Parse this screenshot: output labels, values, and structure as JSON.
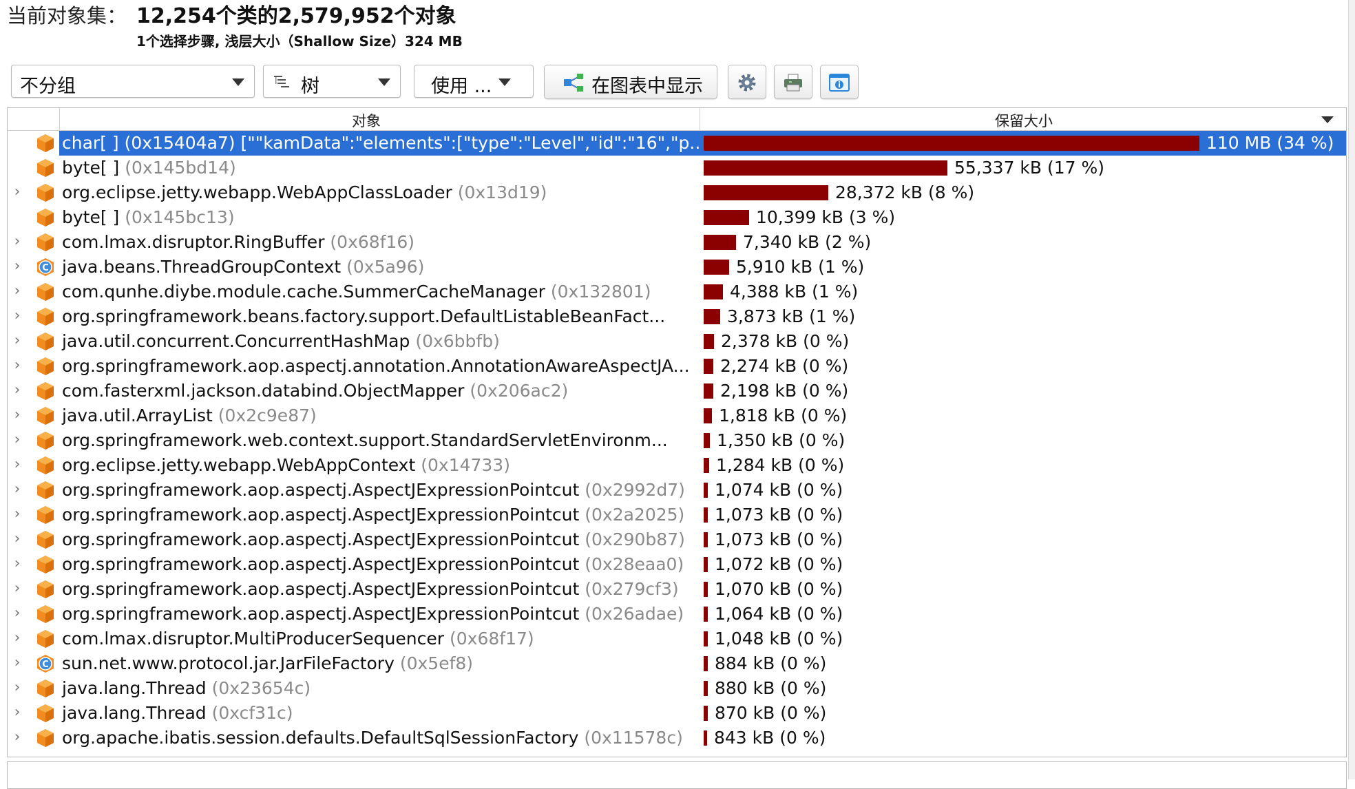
{
  "header": {
    "label": "当前对象集：",
    "title": "12,254个类的2,579,952个对象",
    "subtitle": "1个选择步骤, 浅层大小（Shallow Size）324 MB"
  },
  "toolbar": {
    "group_value": "不分组",
    "view_value": "树",
    "use_label": "使用 ...",
    "show_in_chart_label": "在图表中显示"
  },
  "table": {
    "col_object": "对象",
    "col_retained": "保留大小",
    "rows": [
      {
        "name": "char[ ] (0x15404a7) [\"\"kamData\":\"elements\":[\"type\":\"Level\",\"id\":\"16\",\"p...",
        "addr": "",
        "value": "110 MB (34 %)",
        "fraction": 1.0,
        "icon": "orange-cube-icon",
        "expandable": false,
        "selected": true
      },
      {
        "name": "byte[ ] ",
        "addr": "(0x145bd14)",
        "value": "55,337 kB (17 %)",
        "fraction": 0.491,
        "icon": "orange-cube-icon",
        "expandable": false
      },
      {
        "name": "org.eclipse.jetty.webapp.WebAppClassLoader ",
        "addr": "(0x13d19)",
        "value": "28,372 kB (8 %)",
        "fraction": 0.252,
        "icon": "orange-cube-icon",
        "expandable": true
      },
      {
        "name": "byte[ ] ",
        "addr": "(0x145bc13)",
        "value": "10,399 kB (3 %)",
        "fraction": 0.092,
        "icon": "orange-cube-icon",
        "expandable": false
      },
      {
        "name": "com.lmax.disruptor.RingBuffer ",
        "addr": "(0x68f16)",
        "value": "7,340 kB (2 %)",
        "fraction": 0.065,
        "icon": "orange-cube-icon",
        "expandable": true
      },
      {
        "name": "java.beans.ThreadGroupContext ",
        "addr": "(0x5a96)",
        "value": "5,910 kB (1 %)",
        "fraction": 0.052,
        "icon": "class-c-icon",
        "expandable": true
      },
      {
        "name": "com.qunhe.diybe.module.cache.SummerCacheManager ",
        "addr": "(0x132801)",
        "value": "4,388 kB (1 %)",
        "fraction": 0.039,
        "icon": "orange-cube-icon",
        "expandable": true
      },
      {
        "name": "org.springframework.beans.factory.support.DefaultListableBeanFact...",
        "addr": "",
        "value": "3,873 kB (1 %)",
        "fraction": 0.034,
        "icon": "orange-cube-icon",
        "expandable": true
      },
      {
        "name": "java.util.concurrent.ConcurrentHashMap ",
        "addr": "(0x6bbfb)",
        "value": "2,378 kB (0 %)",
        "fraction": 0.021,
        "icon": "orange-cube-icon",
        "expandable": true
      },
      {
        "name": "org.springframework.aop.aspectj.annotation.AnnotationAwareAspectJA...",
        "addr": "",
        "value": "2,274 kB (0 %)",
        "fraction": 0.02,
        "icon": "orange-cube-icon",
        "expandable": true
      },
      {
        "name": "com.fasterxml.jackson.databind.ObjectMapper ",
        "addr": "(0x206ac2)",
        "value": "2,198 kB (0 %)",
        "fraction": 0.019,
        "icon": "orange-cube-icon",
        "expandable": true
      },
      {
        "name": "java.util.ArrayList ",
        "addr": "(0x2c9e87)",
        "value": "1,818 kB (0 %)",
        "fraction": 0.016,
        "icon": "orange-cube-icon",
        "expandable": true
      },
      {
        "name": "org.springframework.web.context.support.StandardServletEnvironm...",
        "addr": "",
        "value": "1,350 kB (0 %)",
        "fraction": 0.012,
        "icon": "orange-cube-icon",
        "expandable": true
      },
      {
        "name": "org.eclipse.jetty.webapp.WebAppContext ",
        "addr": "(0x14733)",
        "value": "1,284 kB (0 %)",
        "fraction": 0.011,
        "icon": "orange-cube-icon",
        "expandable": true
      },
      {
        "name": "org.springframework.aop.aspectj.AspectJExpressionPointcut ",
        "addr": "(0x2992d7)",
        "value": "1,074 kB (0 %)",
        "fraction": 0.009,
        "icon": "orange-cube-icon",
        "expandable": true
      },
      {
        "name": "org.springframework.aop.aspectj.AspectJExpressionPointcut ",
        "addr": "(0x2a2025)",
        "value": "1,073 kB (0 %)",
        "fraction": 0.009,
        "icon": "orange-cube-icon",
        "expandable": true
      },
      {
        "name": "org.springframework.aop.aspectj.AspectJExpressionPointcut ",
        "addr": "(0x290b87)",
        "value": "1,073 kB (0 %)",
        "fraction": 0.009,
        "icon": "orange-cube-icon",
        "expandable": true
      },
      {
        "name": "org.springframework.aop.aspectj.AspectJExpressionPointcut ",
        "addr": "(0x28eaa0)",
        "value": "1,072 kB (0 %)",
        "fraction": 0.009,
        "icon": "orange-cube-icon",
        "expandable": true
      },
      {
        "name": "org.springframework.aop.aspectj.AspectJExpressionPointcut ",
        "addr": "(0x279cf3)",
        "value": "1,070 kB (0 %)",
        "fraction": 0.009,
        "icon": "orange-cube-icon",
        "expandable": true
      },
      {
        "name": "org.springframework.aop.aspectj.AspectJExpressionPointcut ",
        "addr": "(0x26adae)",
        "value": "1,064 kB (0 %)",
        "fraction": 0.009,
        "icon": "orange-cube-icon",
        "expandable": true
      },
      {
        "name": "com.lmax.disruptor.MultiProducerSequencer ",
        "addr": "(0x68f17)",
        "value": "1,048 kB (0 %)",
        "fraction": 0.009,
        "icon": "orange-cube-icon",
        "expandable": true
      },
      {
        "name": "sun.net.www.protocol.jar.JarFileFactory ",
        "addr": "(0x5ef8)",
        "value": "884 kB (0 %)",
        "fraction": 0.008,
        "icon": "class-c-icon",
        "expandable": true
      },
      {
        "name": "java.lang.Thread ",
        "addr": "(0x23654c)",
        "value": "880 kB (0 %)",
        "fraction": 0.008,
        "icon": "orange-cube-icon",
        "expandable": true
      },
      {
        "name": "java.lang.Thread ",
        "addr": "(0xcf31c)",
        "value": "870 kB (0 %)",
        "fraction": 0.008,
        "icon": "orange-cube-icon",
        "expandable": true
      },
      {
        "name": "org.apache.ibatis.session.defaults.DefaultSqlSessionFactory ",
        "addr": "(0x11578c)",
        "value": "843 kB (0 %)",
        "fraction": 0.007,
        "icon": "orange-cube-icon",
        "expandable": true
      }
    ]
  }
}
